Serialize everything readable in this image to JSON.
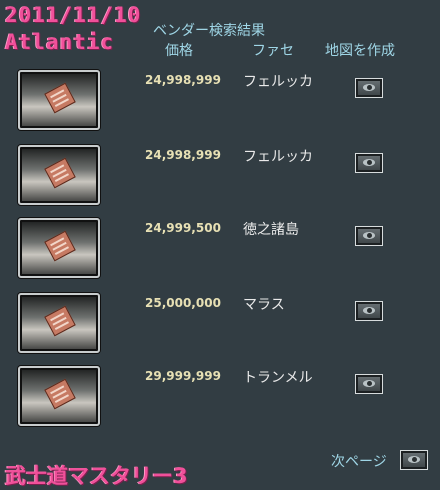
{
  "overlay": {
    "date": "2011/11/10",
    "server": "Atlantic",
    "caption": "武士道マスタリー3"
  },
  "header": {
    "title": "ベンダー検索結果",
    "col_price": "価格",
    "col_faction": "ファセ",
    "col_map": "地図を作成"
  },
  "results": [
    {
      "price": "24,998,999",
      "faction": "フェルッカ",
      "icon": "book-icon",
      "map_icon": "eye-icon"
    },
    {
      "price": "24,998,999",
      "faction": "フェルッカ",
      "icon": "book-icon",
      "map_icon": "eye-icon"
    },
    {
      "price": "24,999,500",
      "faction": "徳之諸島",
      "icon": "book-icon",
      "map_icon": "eye-icon"
    },
    {
      "price": "25,000,000",
      "faction": "マラス",
      "icon": "book-icon",
      "map_icon": "eye-icon"
    },
    {
      "price": "29,999,999",
      "faction": "トランメル",
      "icon": "book-icon",
      "map_icon": "eye-icon"
    }
  ],
  "footer": {
    "next_label": "次ページ",
    "next_icon": "eye-icon"
  }
}
